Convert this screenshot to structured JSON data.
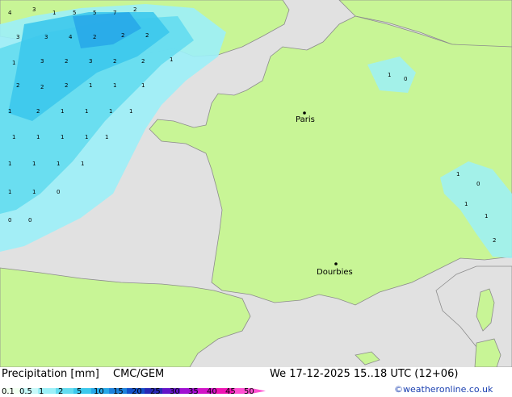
{
  "map": {
    "cities": [
      {
        "name": "Paris"
      },
      {
        "name": "Dourbies"
      }
    ]
  },
  "footer": {
    "title": "Precipitation [mm]",
    "model": "CMC/GEM",
    "valid_time": "We 17-12-2025 15..18 UTC (12+06)",
    "credit": "©weatheronline.co.uk"
  },
  "colorbar": {
    "labels": [
      "0.1",
      "0.5",
      "1",
      "2",
      "5",
      "10",
      "15",
      "20",
      "25",
      "30",
      "35",
      "40",
      "45",
      "50"
    ],
    "colors": [
      "#f0fff0",
      "#c8fafa",
      "#9cf0f8",
      "#64dcf0",
      "#3cc8ec",
      "#28a8e8",
      "#1e82dc",
      "#1450c8",
      "#2828b4",
      "#6414c8",
      "#a010d2",
      "#d214c8",
      "#f014b4",
      "#ff50d2"
    ]
  },
  "style": {
    "sea": "#e1e1e1",
    "land_forecast": "#c8f596",
    "land_outside": "#e1e1e1"
  }
}
